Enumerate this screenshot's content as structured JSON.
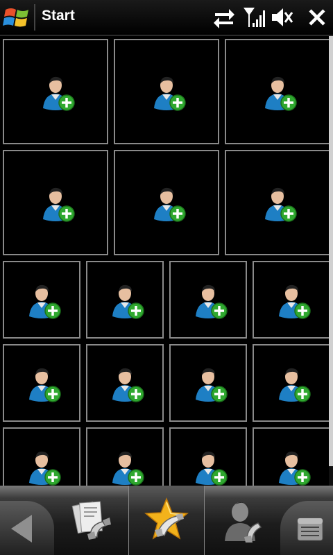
{
  "statusbar": {
    "title": "Start",
    "icons": [
      "windows-logo-icon",
      "data-sync-icon",
      "signal-strength-icon",
      "volume-mute-icon",
      "close-icon"
    ]
  },
  "grid": {
    "tile_icon": "add-contact-icon",
    "rows": [
      {
        "tiles": 3
      },
      {
        "tiles": 3
      },
      {
        "tiles": 4
      },
      {
        "tiles": 4
      },
      {
        "tiles": 4
      }
    ]
  },
  "bottombar": {
    "tabs": [
      {
        "name": "back-button",
        "icon": "back-arrow-icon"
      },
      {
        "name": "tab-call-history",
        "icon": "call-history-icon"
      },
      {
        "name": "tab-favorites",
        "icon": "favorite-star-phone-icon",
        "active": true
      },
      {
        "name": "tab-contacts",
        "icon": "contact-phone-icon"
      },
      {
        "name": "menu-button",
        "icon": "menu-icon"
      }
    ]
  },
  "colors": {
    "background": "#000000",
    "tile_border": "#8a8a8a",
    "plus_green": "#2fa82f",
    "shirt_blue": "#1e7fc4",
    "star_gold": "#f2b21b"
  }
}
